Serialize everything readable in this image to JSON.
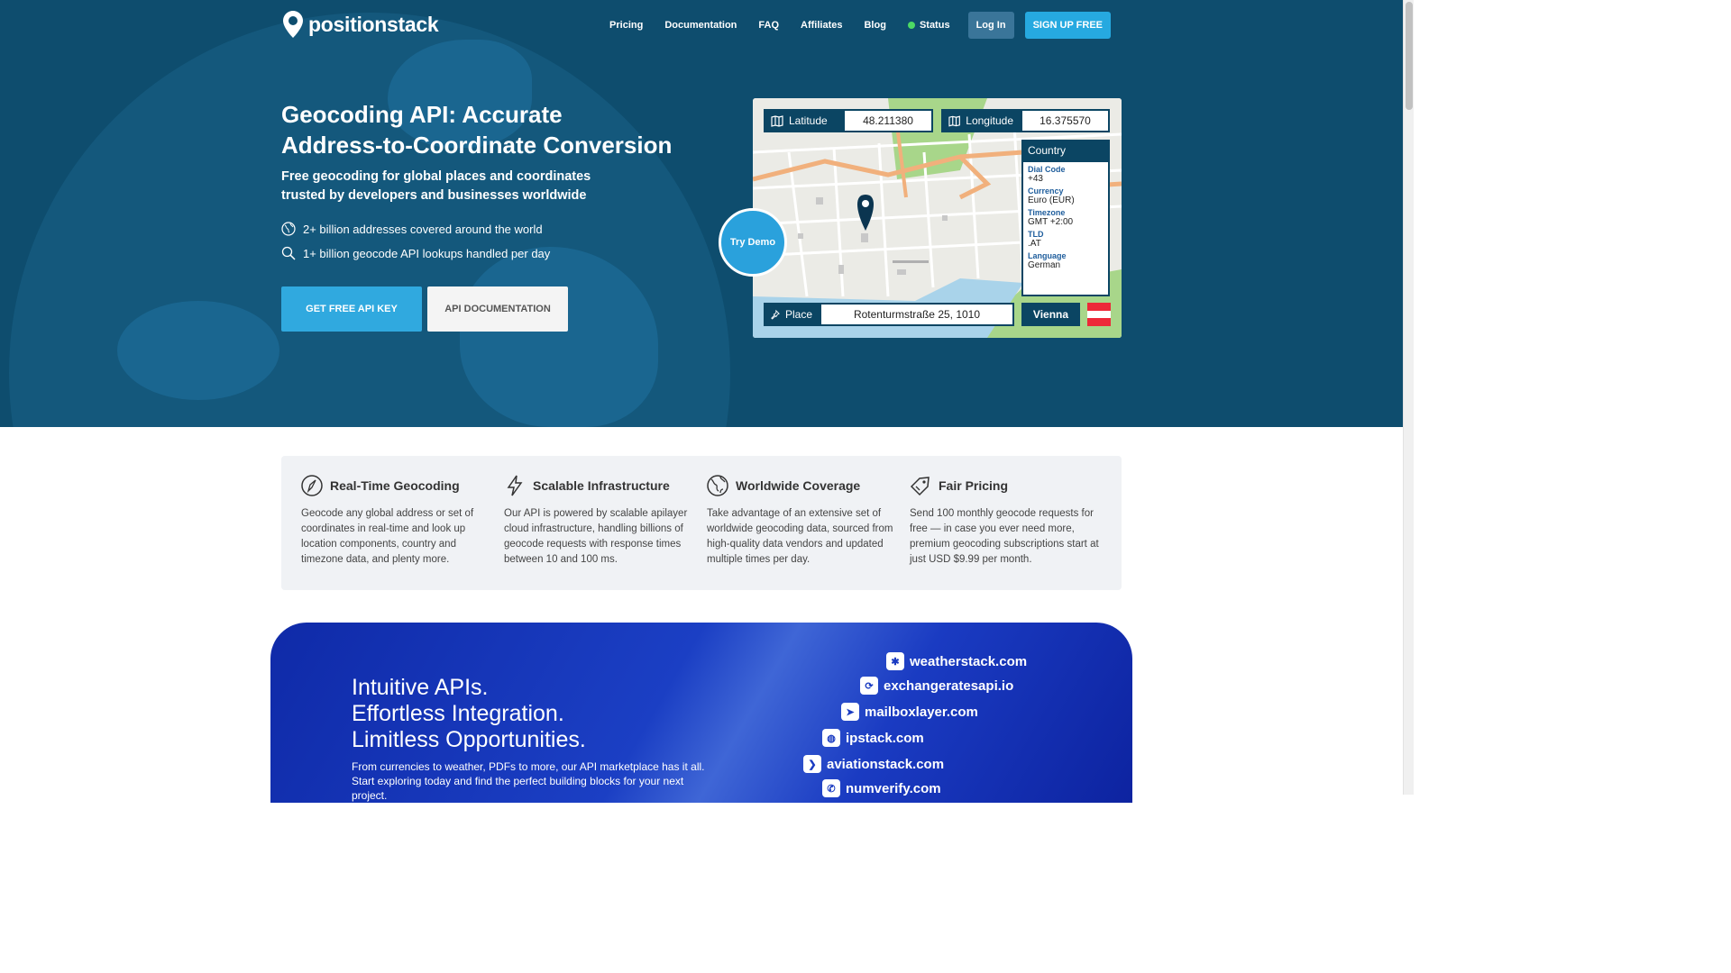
{
  "brand": {
    "name": "positionstack"
  },
  "nav": {
    "items": [
      "Pricing",
      "Documentation",
      "FAQ",
      "Affiliates",
      "Blog"
    ],
    "status": "Status",
    "login": "Log In",
    "signup": "SIGN UP FREE"
  },
  "hero": {
    "title_line1": "Geocoding API: Accurate",
    "title_line2": "Address-to-Coordinate Conversion",
    "subtitle_line1": "Free geocoding for global places and coordinates",
    "subtitle_line2": "trusted by developers and businesses worldwide",
    "stats": [
      "2+ billion addresses covered around the world",
      "1+ billion geocode API lookups handled per day"
    ],
    "cta_primary": "GET FREE API KEY",
    "cta_secondary": "API DOCUMENTATION"
  },
  "demo": {
    "latitude_label": "Latitude",
    "latitude_value": "48.211380",
    "longitude_label": "Longitude",
    "longitude_value": "16.375570",
    "country": {
      "title": "Country",
      "fields": [
        {
          "key": "Dial Code",
          "value": "+43"
        },
        {
          "key": "Currency",
          "value": "Euro (EUR)"
        },
        {
          "key": "Timezone",
          "value": "GMT +2:00"
        },
        {
          "key": "TLD",
          "value": ".AT"
        },
        {
          "key": "Language",
          "value": "German"
        }
      ]
    },
    "place_label": "Place",
    "place_value": "Rotenturmstraße 25, 1010",
    "city": "Vienna",
    "try_demo": "Try Demo"
  },
  "features": [
    {
      "icon": "compass-icon",
      "title": "Real-Time Geocoding",
      "text": "Geocode any global address or set of coordinates in real-time and look up location components, country and timezone data, and plenty more."
    },
    {
      "icon": "lightning-icon",
      "title": "Scalable Infrastructure",
      "text": "Our API is powered by scalable apilayer cloud infrastructure, handling billions of geocode requests with response times between 10 and 100 ms."
    },
    {
      "icon": "globe-icon",
      "title": "Worldwide Coverage",
      "text": "Take advantage of an extensive set of worldwide geocoding data, sourced from high-quality data vendors and updated multiple times per day."
    },
    {
      "icon": "price-tag-icon",
      "title": "Fair Pricing",
      "text": "Send 100 monthly geocode requests for free — in case you ever need more, premium geocoding subscriptions start at just USD $9.99 per month."
    }
  ],
  "marketplace": {
    "line1": "Intuitive APIs.",
    "line2": "Effortless Integration.",
    "line3": "Limitless Opportunities.",
    "description": "From currencies to weather, PDFs to more, our API marketplace has it all. Start exploring today and find the perfect building blocks for your next project.",
    "brands": [
      "weatherstack.com",
      "exchangeratesapi.io",
      "mailboxlayer.com",
      "ipstack.com",
      "aviationstack.com",
      "numverify.com"
    ]
  },
  "colors": {
    "hero_bg": "#0e4d6e",
    "accent": "#26a9e0",
    "demo_dark": "#0b4563",
    "market_blue": "#1b3fc4"
  }
}
